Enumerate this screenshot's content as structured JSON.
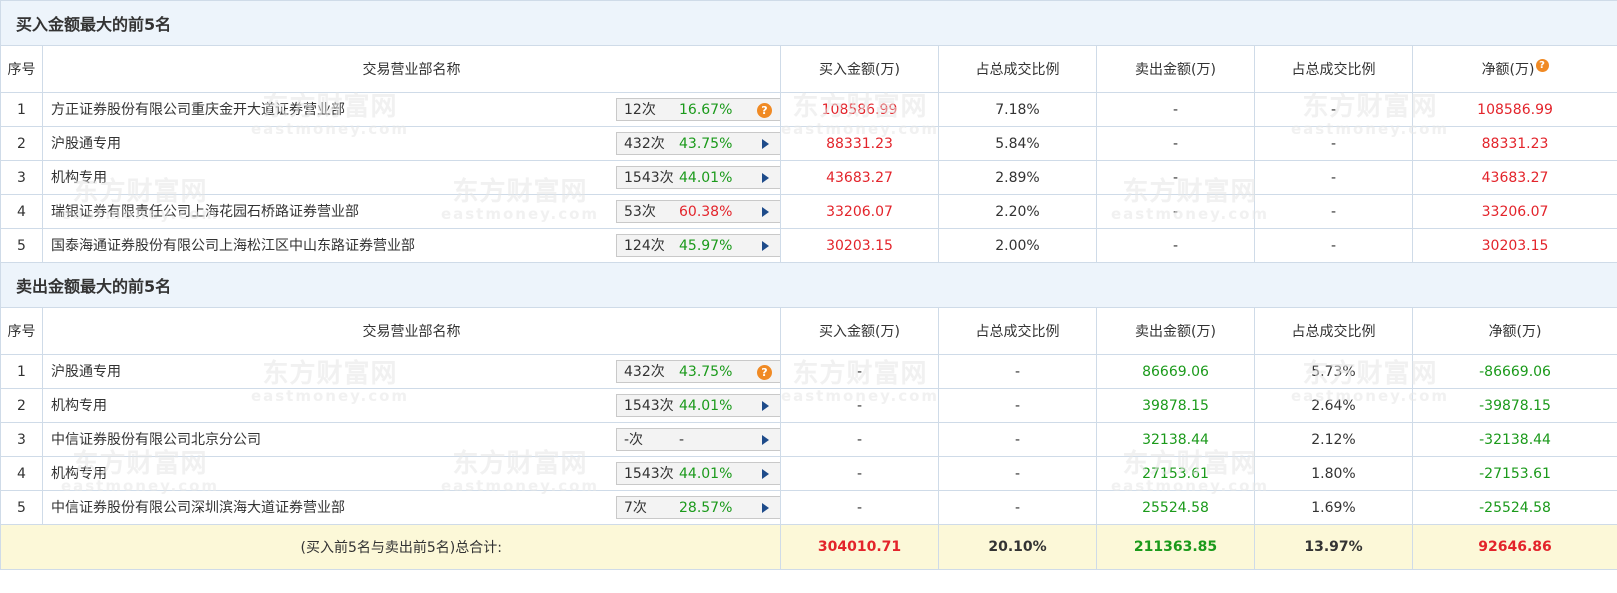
{
  "buy_section": {
    "title": "买入金额最大的前5名",
    "headers": {
      "idx": "序号",
      "name": "交易营业部名称",
      "buy": "买入金额(万)",
      "buy_pct": "占总成交比例",
      "sell": "卖出金额(万)",
      "sell_pct": "占总成交比例",
      "net": "净额(万)"
    },
    "rows": [
      {
        "idx": "1",
        "name": "方正证券股份有限公司重庆金开大道证券营业部",
        "count": "12次",
        "pct": "16.67%",
        "icon": "question-icon",
        "buy": "108586.99",
        "buy_pct": "7.18%",
        "sell": "-",
        "sell_pct": "-",
        "net": "108586.99"
      },
      {
        "idx": "2",
        "name": "沪股通专用",
        "count": "432次",
        "pct": "43.75%",
        "icon": "arrow-right-icon",
        "buy": "88331.23",
        "buy_pct": "5.84%",
        "sell": "-",
        "sell_pct": "-",
        "net": "88331.23"
      },
      {
        "idx": "3",
        "name": "机构专用",
        "count": "1543次",
        "pct": "44.01%",
        "icon": "arrow-right-icon",
        "buy": "43683.27",
        "buy_pct": "2.89%",
        "sell": "-",
        "sell_pct": "-",
        "net": "43683.27"
      },
      {
        "idx": "4",
        "name": "瑞银证券有限责任公司上海花园石桥路证券营业部",
        "count": "53次",
        "pct": "60.38%",
        "icon": "arrow-right-icon",
        "buy": "33206.07",
        "buy_pct": "2.20%",
        "sell": "-",
        "sell_pct": "-",
        "net": "33206.07"
      },
      {
        "idx": "5",
        "name": "国泰海通证券股份有限公司上海松江区中山东路证券营业部",
        "count": "124次",
        "pct": "45.97%",
        "icon": "arrow-right-icon",
        "buy": "30203.15",
        "buy_pct": "2.00%",
        "sell": "-",
        "sell_pct": "-",
        "net": "30203.15"
      }
    ]
  },
  "sell_section": {
    "title": "卖出金额最大的前5名",
    "headers": {
      "idx": "序号",
      "name": "交易营业部名称",
      "buy": "买入金额(万)",
      "buy_pct": "占总成交比例",
      "sell": "卖出金额(万)",
      "sell_pct": "占总成交比例",
      "net": "净额(万)"
    },
    "rows": [
      {
        "idx": "1",
        "name": "沪股通专用",
        "count": "432次",
        "pct": "43.75%",
        "icon": "question-icon",
        "buy": "-",
        "buy_pct": "-",
        "sell": "86669.06",
        "sell_pct": "5.73%",
        "net": "-86669.06"
      },
      {
        "idx": "2",
        "name": "机构专用",
        "count": "1543次",
        "pct": "44.01%",
        "icon": "arrow-right-icon",
        "buy": "-",
        "buy_pct": "-",
        "sell": "39878.15",
        "sell_pct": "2.64%",
        "net": "-39878.15"
      },
      {
        "idx": "3",
        "name": "中信证券股份有限公司北京分公司",
        "count": "-次",
        "pct": "-",
        "icon": "arrow-right-icon",
        "buy": "-",
        "buy_pct": "-",
        "sell": "32138.44",
        "sell_pct": "2.12%",
        "net": "-32138.44"
      },
      {
        "idx": "4",
        "name": "机构专用",
        "count": "1543次",
        "pct": "44.01%",
        "icon": "arrow-right-icon",
        "buy": "-",
        "buy_pct": "-",
        "sell": "27153.61",
        "sell_pct": "1.80%",
        "net": "-27153.61"
      },
      {
        "idx": "5",
        "name": "中信证券股份有限公司深圳滨海大道证券营业部",
        "count": "7次",
        "pct": "28.57%",
        "icon": "arrow-right-icon",
        "buy": "-",
        "buy_pct": "-",
        "sell": "25524.58",
        "sell_pct": "1.69%",
        "net": "-25524.58"
      }
    ]
  },
  "total": {
    "label": "(买入前5名与卖出前5名)总合计:",
    "buy": "304010.71",
    "buy_pct": "20.10%",
    "sell": "211363.85",
    "sell_pct": "13.97%",
    "net": "92646.86"
  },
  "watermark": {
    "cn": "东方财富网",
    "en": "eastmoney.com"
  },
  "colors": {
    "positive": "#e3242b",
    "negative": "#1b9a1b",
    "header_bg": "#edf4fb",
    "total_bg": "#fcf8d8",
    "border": "#cfdbe8"
  }
}
